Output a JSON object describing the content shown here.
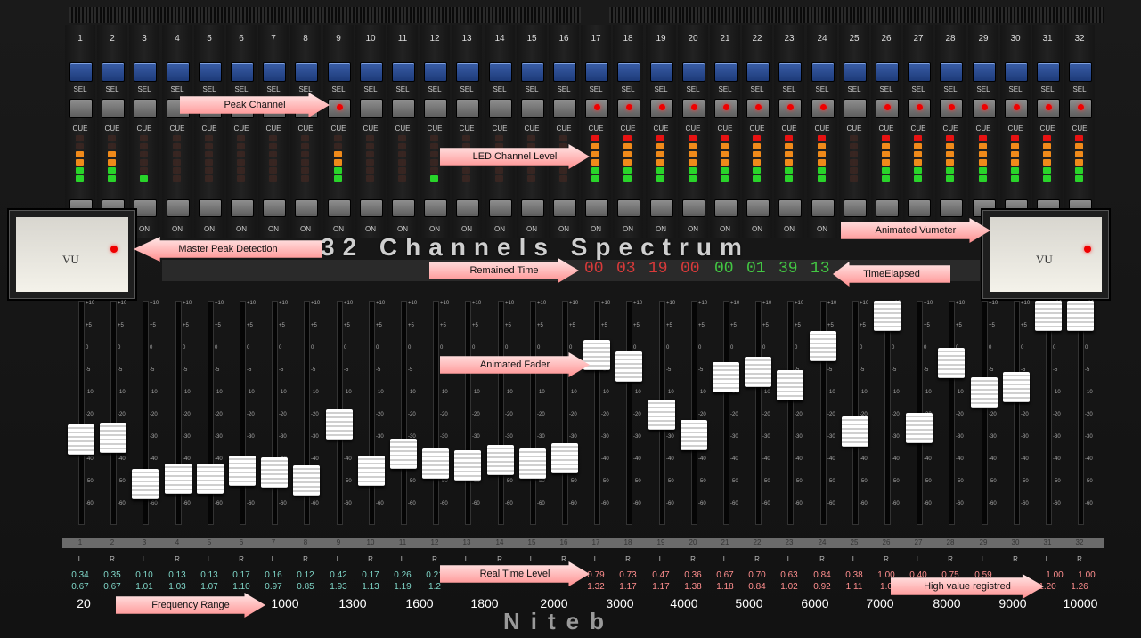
{
  "mixer": {
    "channels": [
      "1",
      "2",
      "3",
      "4",
      "5",
      "6",
      "7",
      "8",
      "9",
      "10",
      "11",
      "12",
      "13",
      "14",
      "15",
      "16",
      "17",
      "18",
      "19",
      "20",
      "21",
      "22",
      "23",
      "24",
      "25",
      "26",
      "27",
      "28",
      "29",
      "30",
      "31",
      "32"
    ],
    "sel_label": "SEL",
    "cue_label": "CUE",
    "on_label": "ON",
    "led_levels": [
      4,
      4,
      1,
      0,
      0,
      0,
      0,
      0,
      4,
      0,
      0,
      1,
      0,
      0,
      0,
      0,
      6,
      6,
      6,
      6,
      6,
      6,
      6,
      6,
      0,
      6,
      6,
      6,
      6,
      6,
      6,
      6
    ],
    "peak_on": [
      false,
      false,
      false,
      false,
      false,
      false,
      false,
      false,
      true,
      false,
      false,
      false,
      false,
      false,
      false,
      false,
      true,
      true,
      true,
      true,
      true,
      true,
      true,
      true,
      false,
      true,
      true,
      true,
      true,
      true,
      true,
      true
    ],
    "fader_levels": [
      0.34,
      0.35,
      0.1,
      0.13,
      0.13,
      0.17,
      0.16,
      0.12,
      0.42,
      0.17,
      0.26,
      0.21,
      0.2,
      0.23,
      0.21,
      0.24,
      0.79,
      0.73,
      0.47,
      0.36,
      0.67,
      0.7,
      0.63,
      0.84,
      0.38,
      1.0,
      0.4,
      0.75,
      0.59,
      0.62,
      1.0,
      1.0
    ],
    "lr_labels": [
      "L",
      "R",
      "L",
      "R",
      "L",
      "R",
      "L",
      "R",
      "L",
      "R",
      "L",
      "R",
      "L",
      "R",
      "L",
      "R",
      "L",
      "R",
      "L",
      "R",
      "L",
      "R",
      "L",
      "R",
      "L",
      "R",
      "L",
      "R",
      "L",
      "R",
      "L",
      "R"
    ],
    "level_top": [
      "0.34",
      "0.35",
      "0.10",
      "0.13",
      "0.13",
      "0.17",
      "0.16",
      "0.12",
      "0.42",
      "0.17",
      "0.26",
      "0.21",
      "",
      "",
      "",
      "",
      "0.79",
      "0.73",
      "0.47",
      "0.36",
      "0.67",
      "0.70",
      "0.63",
      "0.84",
      "0.38",
      "1.00",
      "0.40",
      "0.75",
      "0.59",
      "",
      "",
      ""
    ],
    "level_bottom": [
      "0.67",
      "0.67",
      "1.01",
      "1.03",
      "1.07",
      "1.10",
      "0.97",
      "0.85",
      "1.93",
      "1.13",
      "1.19",
      "1.2",
      "",
      "",
      "",
      "",
      "1.32",
      "1.17",
      "1.17",
      "1.38",
      "1.18",
      "0.84",
      "1.02",
      "0.92",
      "1.11",
      "1.0",
      "",
      "",
      "",
      "",
      "1.20",
      "1.26"
    ],
    "level_top_right": [
      "1.00",
      "1.00"
    ],
    "frequencies": [
      "20",
      "1000",
      "1300",
      "1600",
      "1800",
      "2000",
      "3000",
      "4000",
      "5000",
      "6000",
      "7000",
      "8000",
      "9000",
      "10000"
    ],
    "title": "32 Channels Spectrum",
    "time_remaining": [
      "00",
      "03",
      "19",
      "00"
    ],
    "time_elapsed": [
      "00",
      "01",
      "39",
      "13"
    ],
    "brand": "Niteb",
    "fader_scale": [
      "+10",
      "+5",
      "0",
      "-5",
      "-10",
      "-20",
      "-30",
      "-40",
      "-50",
      "-60"
    ],
    "vu_label": "VU"
  },
  "callouts": {
    "peak_channel": "Peak  Channel",
    "led_channel_level": "LED Channel Level",
    "master_peak": "Master Peak Detection",
    "animated_vumeter": "Animated Vumeter",
    "remained_time": "Remained Time",
    "time_elapsed": "TimeElapsed",
    "animated_fader": "Animated Fader",
    "real_time_level": "Real Time Level",
    "high_value": "High value registred",
    "frequency_range": "Frequency Range"
  },
  "colors": {
    "led_green": "#29d42a",
    "led_orange": "#f08a1a",
    "led_red": "#e81212",
    "time_red": "#d93a3a",
    "time_green": "#43c843",
    "level_cyan": "#7fd6c8",
    "level_pink": "#ff8e8e"
  }
}
